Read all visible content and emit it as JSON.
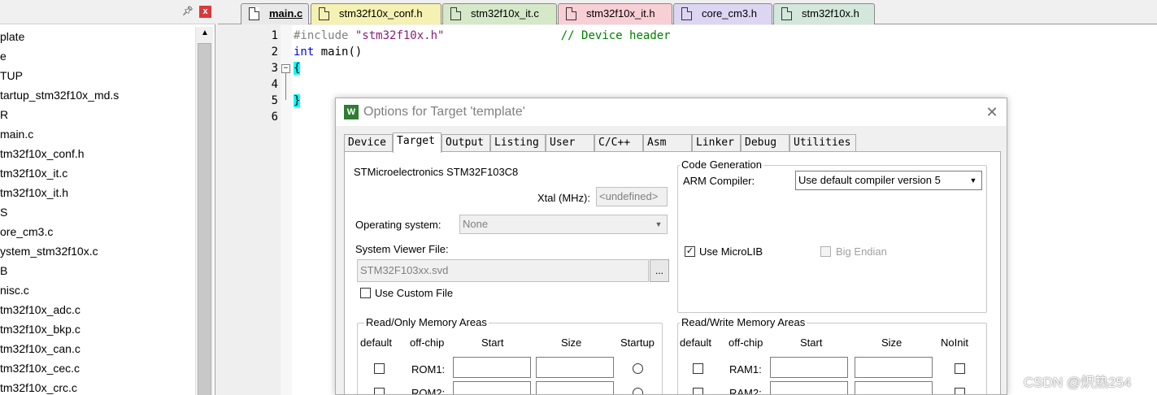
{
  "project_panel": {
    "items": [
      "plate",
      "e",
      "TUP",
      "tartup_stm32f10x_md.s",
      "R",
      "main.c",
      "tm32f10x_conf.h",
      "tm32f10x_it.c",
      "tm32f10x_it.h",
      "S",
      "ore_cm3.c",
      "ystem_stm32f10x.c",
      "B",
      "nisc.c",
      "tm32f10x_adc.c",
      "tm32f10x_bkp.c",
      "tm32f10x_can.c",
      "tm32f10x_cec.c",
      "tm32f10x_crc.c"
    ],
    "pin_icon": "pin-icon",
    "close_label": "x"
  },
  "editor_tabs": [
    {
      "label": "main.c",
      "color": "#e9e9e9",
      "active": true
    },
    {
      "label": "stm32f10x_conf.h",
      "color": "#f4f1b2"
    },
    {
      "label": "stm32f10x_it.c",
      "color": "#d5e8c8"
    },
    {
      "label": "stm32f10x_it.h",
      "color": "#f8cfd5"
    },
    {
      "label": "core_cm3.h",
      "color": "#dcd6f2"
    },
    {
      "label": "stm32f10x.h",
      "color": "#d3e7dc"
    }
  ],
  "editor": {
    "line_numbers": [
      "1",
      "2",
      "3",
      "4",
      "5",
      "6"
    ],
    "lines": {
      "l1_directive": "#include",
      "l1_string": "\"stm32f10x.h\"",
      "l1_comment": "// Device header",
      "l2_kw": "int",
      "l2_rest": "main()",
      "l3": "{",
      "l4": "",
      "l5": "}",
      "l6": ""
    },
    "fold_symbol": "−"
  },
  "dialog": {
    "title": "Options for Target 'template'",
    "close_label": "✕",
    "icon_label": "W",
    "tabs": [
      "Device",
      "Target",
      "Output",
      "Listing",
      "User",
      "C/C++",
      "Asm",
      "Linker",
      "Debug",
      "Utilities"
    ],
    "active_tab": "Target",
    "device_name": "STMicroelectronics STM32F103C8",
    "xtal_label": "Xtal (MHz):",
    "xtal_value": "<undefined>",
    "os_label": "Operating system:",
    "os_value": "None",
    "svd_label": "System Viewer File:",
    "svd_value": "STM32F103xx.svd",
    "svd_browse": "...",
    "custom_file_label": "Use Custom File",
    "custom_file_checked": false,
    "code_gen": {
      "title": "Code Generation",
      "compiler_label": "ARM Compiler:",
      "compiler_value": "Use default compiler version 5",
      "microlib_label": "Use MicroLIB",
      "microlib_checked": true,
      "big_endian_label": "Big Endian",
      "big_endian_checked": false
    },
    "ro_memory": {
      "title": "Read/Only Memory Areas",
      "headers": [
        "default",
        "off-chip",
        "Start",
        "Size",
        "Startup"
      ],
      "rows": [
        "ROM1:",
        "ROM2:"
      ]
    },
    "rw_memory": {
      "title": "Read/Write Memory Areas",
      "headers": [
        "default",
        "off-chip",
        "Start",
        "Size",
        "NoInit"
      ],
      "rows": [
        "RAM1:",
        "RAM2:"
      ]
    }
  },
  "watermark": "CSDN @炽热254",
  "colors": {
    "brace_highlight": "#00ffff",
    "comment": "#008000",
    "keyword": "#0000ff",
    "string": "#8a1e7a"
  }
}
